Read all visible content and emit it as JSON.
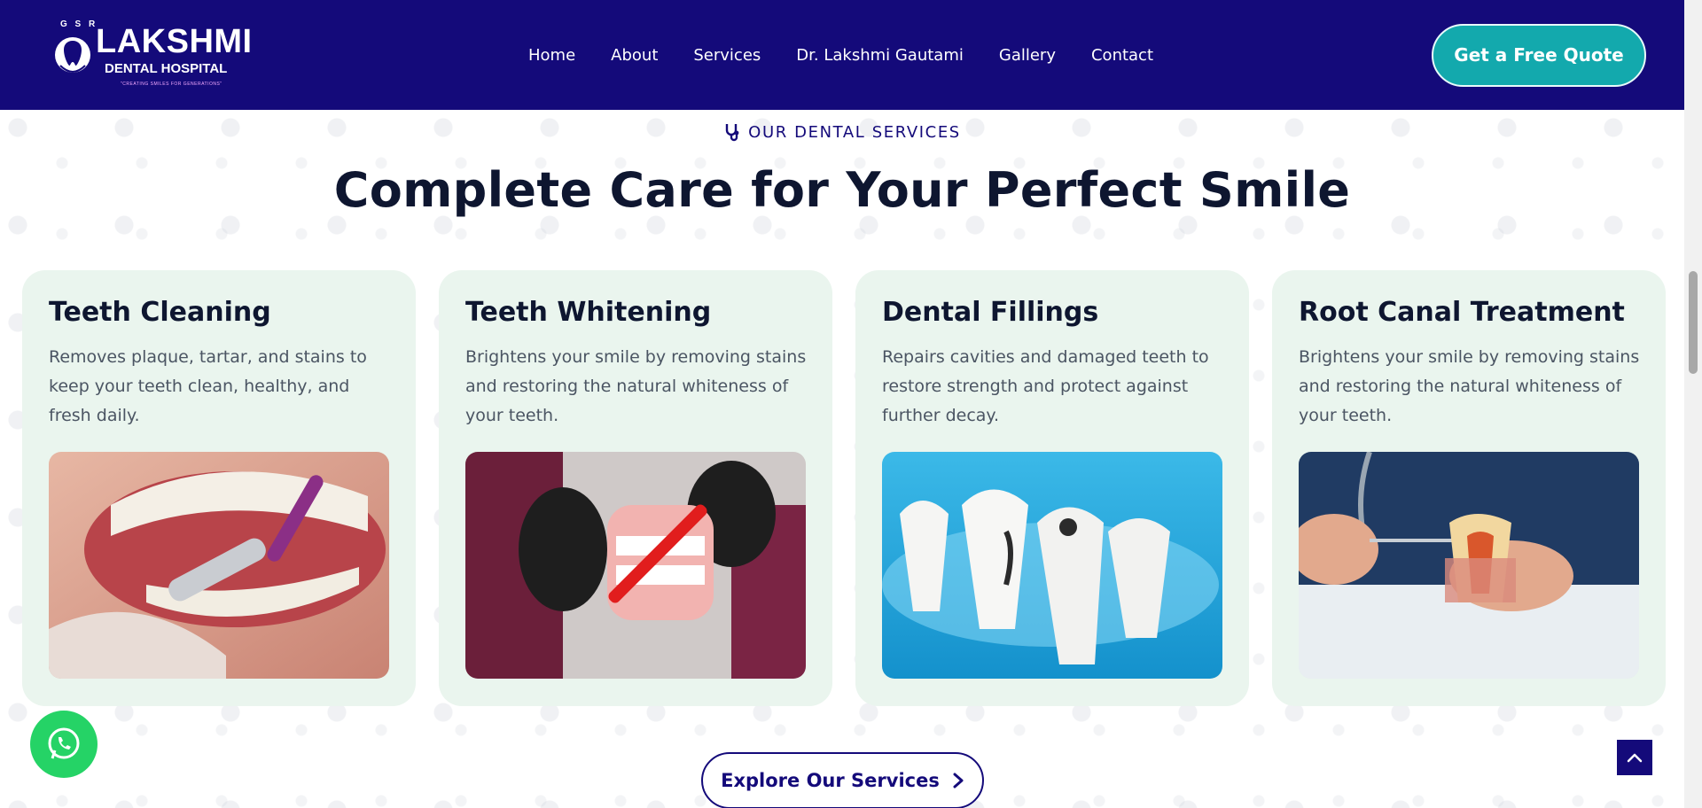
{
  "brand": {
    "prefix": "G S R",
    "name": "LAKSHMI",
    "subtitle": "DENTAL HOSPITAL",
    "tagline": "\"CREATING SMILES FOR GENERATIONS\""
  },
  "nav": {
    "items": [
      "Home",
      "About",
      "Services",
      "Dr. Lakshmi Gautami",
      "Gallery",
      "Contact"
    ],
    "cta": "Get a Free Quote"
  },
  "section": {
    "eyebrow": "OUR DENTAL SERVICES",
    "title": "Complete Care for Your Perfect Smile"
  },
  "cards": [
    {
      "title": "Teeth Cleaning",
      "description": "Removes plaque, tartar, and stains to keep your teeth clean, healthy, and fresh daily.",
      "image_icon": "teeth-cleaning-photo"
    },
    {
      "title": "Teeth Whitening",
      "description": "Brightens your smile by removing stains and restoring the natural whiteness of your teeth.",
      "image_icon": "teeth-whitening-photo"
    },
    {
      "title": "Dental Fillings",
      "description": "Repairs cavities and damaged teeth to restore strength and protect against further decay.",
      "image_icon": "dental-fillings-photo"
    },
    {
      "title": "Root Canal Treatment",
      "description": "Brightens your smile by removing stains and restoring the natural whiteness of your teeth.",
      "image_icon": "root-canal-photo"
    }
  ],
  "explore_label": "Explore Our Services",
  "colors": {
    "header": "#140a7a",
    "accent": "#13a9ad",
    "card_bg": "#eaf5ee",
    "whatsapp": "#25d366"
  }
}
